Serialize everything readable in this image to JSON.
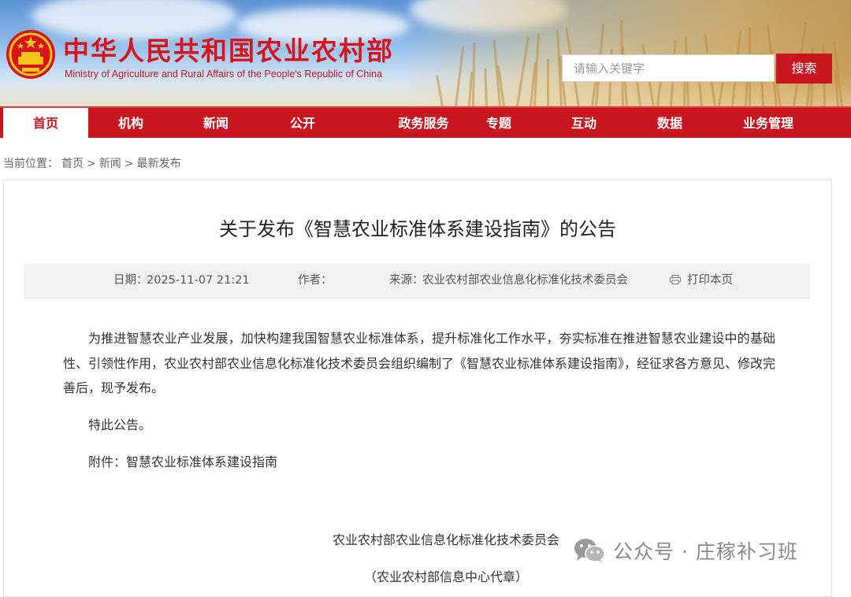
{
  "header": {
    "site_title": "中华人民共和国农业农村部",
    "site_subtitle": "Ministry of Agriculture and Rural Affairs of the People's Republic of China",
    "search_placeholder": "请输入关键字",
    "search_button": "搜索",
    "brand_color": "#c9151e"
  },
  "nav": {
    "items": [
      {
        "label": "首页",
        "active": true
      },
      {
        "label": "机构",
        "active": false
      },
      {
        "label": "新闻",
        "active": false
      },
      {
        "label": "公开",
        "active": false
      },
      {
        "label": "政务服务",
        "active": false
      },
      {
        "label": "专题",
        "active": false
      },
      {
        "label": "互动",
        "active": false
      },
      {
        "label": "数据",
        "active": false
      },
      {
        "label": "业务管理",
        "active": false
      }
    ]
  },
  "breadcrumb": {
    "prefix": "当前位置：",
    "items": [
      "首页",
      "新闻",
      "最新发布"
    ],
    "separator": ">"
  },
  "article": {
    "title": "关于发布《智慧农业标准体系建设指南》的公告",
    "meta": {
      "date_label": "日期：",
      "date_value": "2025-11-07 21:21",
      "author_label": "作者：",
      "author_value": "",
      "source_label": "来源：",
      "source_value": "农业农村部农业信息化标准化技术委员会",
      "print_label": "打印本页"
    },
    "paragraphs": [
      "为推进智慧农业产业发展，加快构建我国智慧农业标准体系，提升标准化工作水平，夯实标准在推进智慧农业建设中的基础性、引领性作用，农业农村部农业信息化标准化技术委员会组织编制了《智慧农业标准体系建设指南》，经征求各方意见、修改完善后，现予发布。",
      "特此公告。"
    ],
    "attachment_label": "附件：",
    "attachment_link": "智慧农业标准体系建设指南",
    "signature_org": "农业农村部农业信息化标准化技术委员会",
    "signature_seal": "（农业农村部信息中心代章）"
  },
  "watermark": {
    "text": "公众号 · 庄稼补习班",
    "icon": "wechat-icon"
  }
}
